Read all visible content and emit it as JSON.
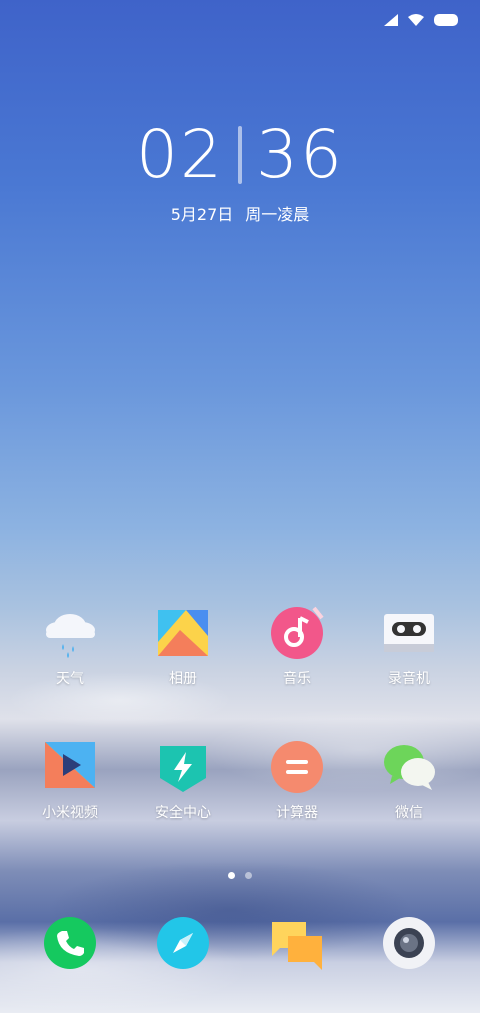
{
  "clock": {
    "hours": "02",
    "minutes": "36",
    "date": "5月27日",
    "weekday": "周一凌晨"
  },
  "apps_row1": [
    {
      "label": "天气",
      "icon": "weather-icon"
    },
    {
      "label": "相册",
      "icon": "gallery-icon"
    },
    {
      "label": "音乐",
      "icon": "music-icon"
    },
    {
      "label": "录音机",
      "icon": "recorder-icon"
    }
  ],
  "apps_row2": [
    {
      "label": "小米视频",
      "icon": "video-icon"
    },
    {
      "label": "安全中心",
      "icon": "security-icon"
    },
    {
      "label": "计算器",
      "icon": "calculator-icon"
    },
    {
      "label": "微信",
      "icon": "wechat-icon"
    }
  ],
  "dock": [
    {
      "icon": "phone-icon"
    },
    {
      "icon": "browser-icon"
    },
    {
      "icon": "messages-icon"
    },
    {
      "icon": "camera-icon"
    }
  ],
  "pager": {
    "pages": 2,
    "current": 1
  },
  "colors": {
    "music": "#f2578a",
    "security": "#1cc4b0",
    "calculator": "#f58a6e",
    "phone": "#15c95f",
    "browser": "#22c6e8",
    "messages": "#ffc95a",
    "wechat": "#6dd55a"
  }
}
